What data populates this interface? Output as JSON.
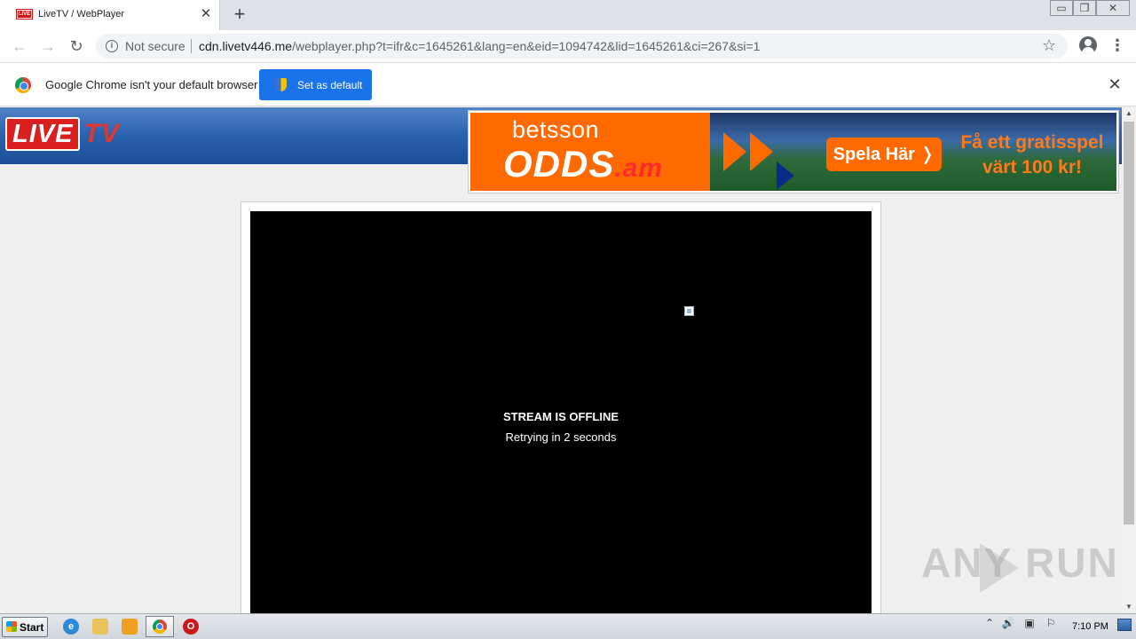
{
  "browser": {
    "tab": {
      "title": "LiveTV / WebPlayer",
      "favicon_text": "LIVE",
      "close_glyph": "✕"
    },
    "new_tab_glyph": "+",
    "window_controls": {
      "minimize": "▭",
      "maximize": "❐",
      "close": "✕"
    },
    "toolbar": {
      "back_glyph": "←",
      "forward_glyph": "→",
      "reload_glyph": "↻",
      "security_label": "Not secure",
      "info_glyph": "i",
      "url_host": "cdn.livetv446.me",
      "url_path": "/webplayer.php?t=ifr&c=1645261&lang=en&eid=1094742&lid=1645261&ci=267&si=1",
      "star_glyph": "☆",
      "menu_glyph": "⋮"
    },
    "infobar": {
      "message": "Google Chrome isn't your default browser",
      "button_label": "Set as default",
      "close_glyph": "✕"
    }
  },
  "page": {
    "logo": {
      "live": "LIVE",
      "tv": "TV"
    },
    "ad": {
      "brand": "betsson",
      "product": "ODDS",
      "product_suffix": ".am",
      "cta": "Spela Här ❭",
      "offer_line1": "Få ett gratisspel",
      "offer_line2": "värt 100 kr!"
    },
    "player": {
      "status_title": "STREAM IS OFFLINE",
      "status_sub": "Retrying in 2 seconds"
    },
    "scrollbar": {
      "up_glyph": "▲",
      "down_glyph": "▼"
    },
    "watermark": "ANY  RUN"
  },
  "taskbar": {
    "start_label": "Start",
    "ie_glyph": "e",
    "opera_glyph": "O",
    "tray": {
      "chevron": "⌃",
      "speaker": "🔊",
      "network": "▣",
      "flag": "⚐"
    },
    "clock": "7:10 PM"
  },
  "colors": {
    "chrome_blue": "#1a73e8",
    "livetv_red": "#d9201f",
    "header_blue": "#2d63b0",
    "ad_orange": "#ff6a00",
    "player_bg": "#000000"
  },
  "icons": [
    "live-favicon-icon",
    "close-icon",
    "plus-icon",
    "back-arrow-icon",
    "forward-arrow-icon",
    "reload-icon",
    "info-icon",
    "star-icon",
    "account-icon",
    "menu-icon",
    "chrome-logo-icon",
    "shield-icon",
    "broken-image-icon",
    "start-flag-icon",
    "ie-icon",
    "folder-icon",
    "media-player-icon",
    "chrome-icon",
    "opera-icon",
    "speaker-icon",
    "network-icon",
    "flag-icon"
  ]
}
